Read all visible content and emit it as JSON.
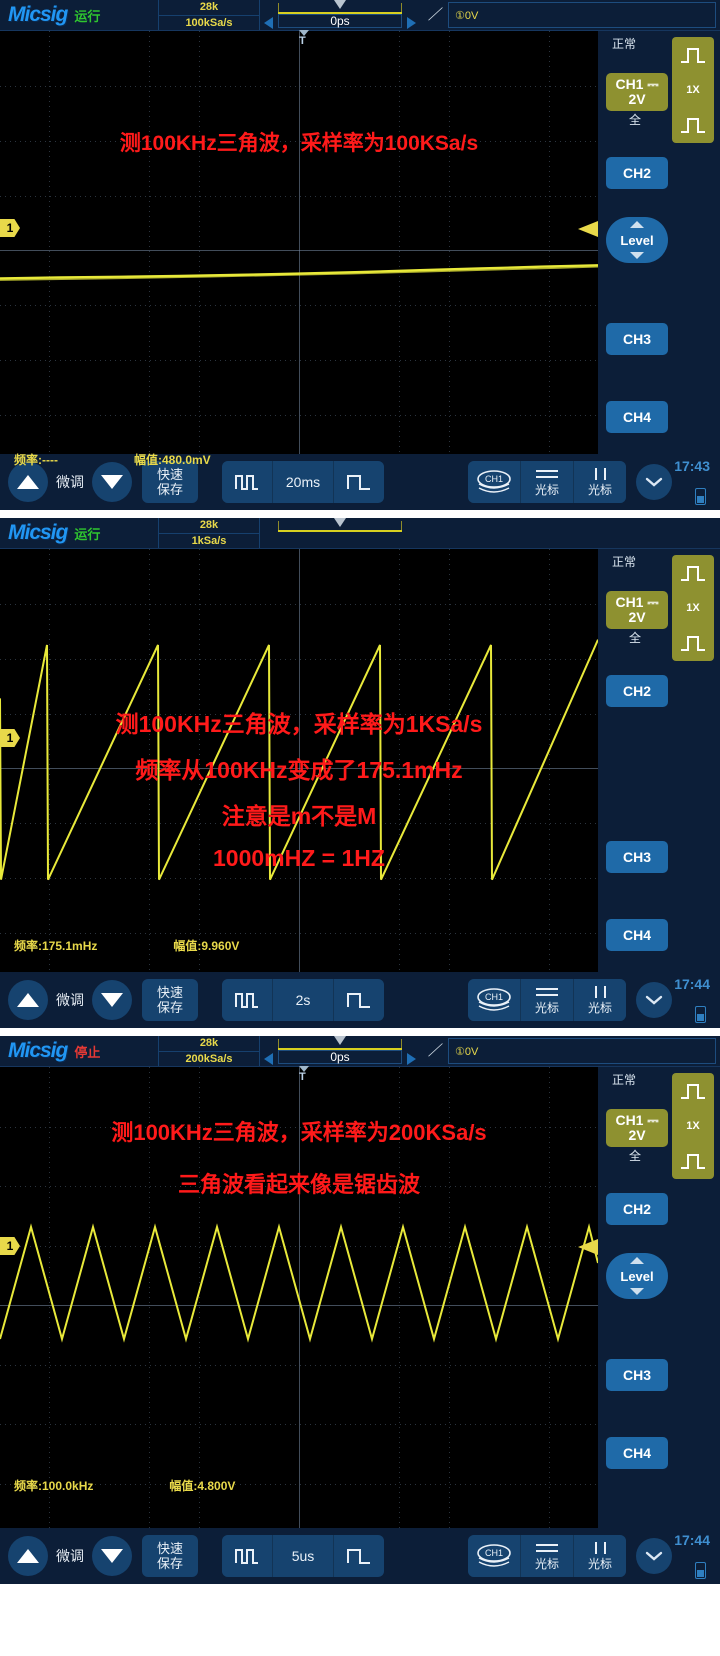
{
  "panels": [
    {
      "header": {
        "brand": "Micsig",
        "state": "运行",
        "state_color": "#2fc62f",
        "memory_depth": "28k",
        "sample_rate": "100kSa/s",
        "position": "0ps",
        "slope_icon": "rising-edge-icon",
        "trigger_source": "①0V",
        "trigger_marker": "T"
      },
      "rail": {
        "mode": "正常",
        "ch1_label": "CH1",
        "ch1_coupling_icon": "dc-coupling-icon",
        "ch1_scale": "2V",
        "ch1_bandwidth": "全",
        "probe": "1X",
        "ch2": "CH2",
        "ch3": "CH3",
        "ch4": "CH4",
        "level": "Level"
      },
      "screen": {
        "ch1_marker": "1",
        "annotation": "测100KHz三角波，采样率为100KSa/s",
        "annotation_color": "#ff1a1a",
        "freq_label": "频率:----",
        "amp_label": "幅值:480.0mV"
      },
      "toolbar": {
        "fine_label": "微调",
        "quick_save": "快速\n保存",
        "quick_save_l1": "快速",
        "quick_save_l2": "保存",
        "timebase": "20ms",
        "zoom_out_icon": "compress-wave-icon",
        "zoom_in_icon": "expand-wave-icon",
        "channel_stack": "CH1",
        "hcursor": "光标",
        "vcursor": "光标",
        "more_icon": "chevron-down-icon",
        "clock": "17:43",
        "battery_icon": "battery-icon"
      }
    },
    {
      "header": {
        "brand": "Micsig",
        "state": "运行",
        "state_color": "#2fc62f",
        "memory_depth": "28k",
        "sample_rate": "1kSa/s",
        "position": "",
        "slope_icon": "rising-edge-icon",
        "trigger_source": "",
        "trigger_marker": ""
      },
      "rail": {
        "mode": "正常",
        "ch1_label": "CH1",
        "ch1_coupling_icon": "dc-coupling-icon",
        "ch1_scale": "2V",
        "ch1_bandwidth": "全",
        "probe": "1X",
        "ch2": "CH2",
        "ch3": "CH3",
        "ch4": "CH4",
        "level": ""
      },
      "screen": {
        "ch1_marker": "1",
        "annotation": "测100KHz三角波，采样率为1KSa/s",
        "annotation2": "频率从100KHz变成了175.1mHz",
        "annotation3": "注意是m不是M",
        "annotation4": "1000mHZ = 1HZ",
        "annotation_color": "#ff1a1a",
        "freq_label": "频率:175.1mHz",
        "amp_label": "幅值:9.960V"
      },
      "toolbar": {
        "fine_label": "微调",
        "quick_save_l1": "快速",
        "quick_save_l2": "保存",
        "timebase": "2s",
        "zoom_out_icon": "compress-wave-icon",
        "zoom_in_icon": "expand-wave-icon",
        "channel_stack": "CH1",
        "hcursor": "光标",
        "vcursor": "光标",
        "more_icon": "chevron-down-icon",
        "clock": "17:44",
        "battery_icon": "battery-icon"
      }
    },
    {
      "header": {
        "brand": "Micsig",
        "state": "停止",
        "state_color": "#e53935",
        "memory_depth": "28k",
        "sample_rate": "200kSa/s",
        "position": "0ps",
        "slope_icon": "rising-edge-icon",
        "trigger_source": "①0V",
        "trigger_marker": "T"
      },
      "rail": {
        "mode": "正常",
        "ch1_label": "CH1",
        "ch1_coupling_icon": "dc-coupling-icon",
        "ch1_scale": "2V",
        "ch1_bandwidth": "全",
        "probe": "1X",
        "ch2": "CH2",
        "ch3": "CH3",
        "ch4": "CH4",
        "level": "Level"
      },
      "screen": {
        "ch1_marker": "1",
        "annotation": "测100KHz三角波，采样率为200KSa/s",
        "annotation2": "三角波看起来像是锯齿波",
        "annotation_color": "#ff1a1a",
        "freq_label": "频率:100.0kHz",
        "amp_label": "幅值:4.800V"
      },
      "toolbar": {
        "fine_label": "微调",
        "quick_save_l1": "快速",
        "quick_save_l2": "保存",
        "timebase": "5us",
        "zoom_out_icon": "compress-wave-icon",
        "zoom_in_icon": "expand-wave-icon",
        "channel_stack": "CH1",
        "hcursor": "光标",
        "vcursor": "光标",
        "more_icon": "chevron-down-icon",
        "clock": "17:44",
        "battery_icon": "battery-icon"
      }
    }
  ],
  "waveform_color": "#e8e93a"
}
